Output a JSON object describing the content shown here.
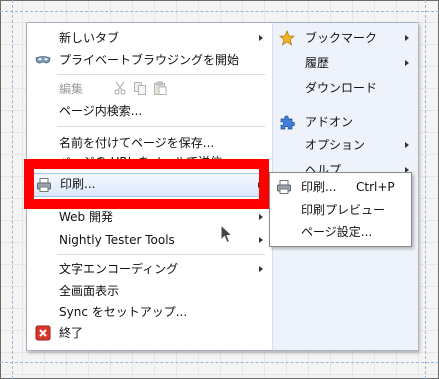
{
  "menu": {
    "left": [
      {
        "label": "新しいタブ",
        "submenu": true
      },
      {
        "label": "プライベートブラウジングを開始",
        "icon": "mask-icon"
      },
      {
        "label": "編集",
        "disabled": true,
        "edit_icons": [
          "cut-icon",
          "copy-icon",
          "paste-icon"
        ]
      },
      {
        "label": "ページ内検索..."
      },
      {
        "label": "名前を付けてページを保存..."
      },
      {
        "label": "ページの URL をメールで送信..."
      },
      {
        "label": "印刷...",
        "submenu": true,
        "icon": "printer-icon",
        "highlighted": true
      },
      {
        "label": "Web 開発",
        "submenu": true
      },
      {
        "label": "Nightly Tester Tools",
        "submenu": true
      },
      {
        "label": "文字エンコーディング",
        "submenu": true
      },
      {
        "label": "全画面表示"
      },
      {
        "label": "Sync をセットアップ..."
      },
      {
        "label": "終了",
        "icon": "exit-icon"
      }
    ],
    "right": [
      {
        "label": "ブックマーク",
        "submenu": true,
        "icon": "star-icon"
      },
      {
        "label": "履歴",
        "submenu": true
      },
      {
        "label": "ダウンロード"
      },
      {
        "label": "アドオン",
        "icon": "puzzle-icon"
      },
      {
        "label": "オプション",
        "submenu": true
      },
      {
        "label": "ヘルプ",
        "submenu": true
      }
    ]
  },
  "print_submenu": {
    "items": [
      {
        "label": "印刷...",
        "shortcut": "Ctrl+P",
        "icon": "printer-icon"
      },
      {
        "label": "印刷プレビュー"
      },
      {
        "label": "ページ設定..."
      }
    ]
  },
  "colors": {
    "highlight_border": "#ff0000",
    "hover_bg": "#dbe8fb",
    "right_pane_bg": "#eef3fb"
  }
}
